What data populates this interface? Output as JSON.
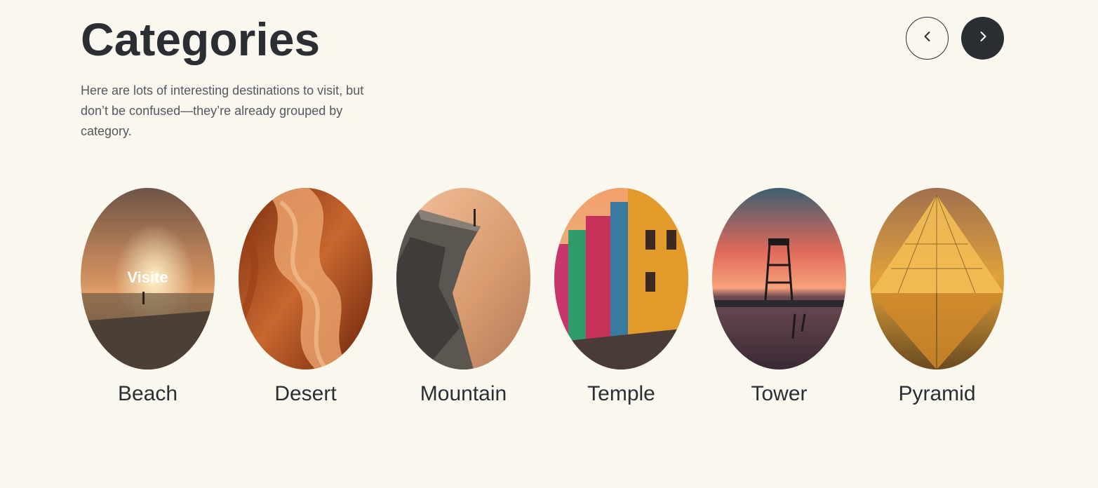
{
  "header": {
    "title": "Categories",
    "description": "Here are lots of interesting destinations to visit, but don’t be confused—they’re already grouped by category."
  },
  "nav": {
    "prev_icon": "chevron-left-icon",
    "next_icon": "chevron-right-icon"
  },
  "categories": [
    {
      "label": "Beach",
      "overlay": "Visite"
    },
    {
      "label": "Desert"
    },
    {
      "label": "Mountain"
    },
    {
      "label": "Temple"
    },
    {
      "label": "Tower"
    },
    {
      "label": "Pyramid"
    }
  ],
  "colors": {
    "background": "#faf7ee",
    "text": "#2b2e33",
    "accent": "#2b2e33"
  }
}
